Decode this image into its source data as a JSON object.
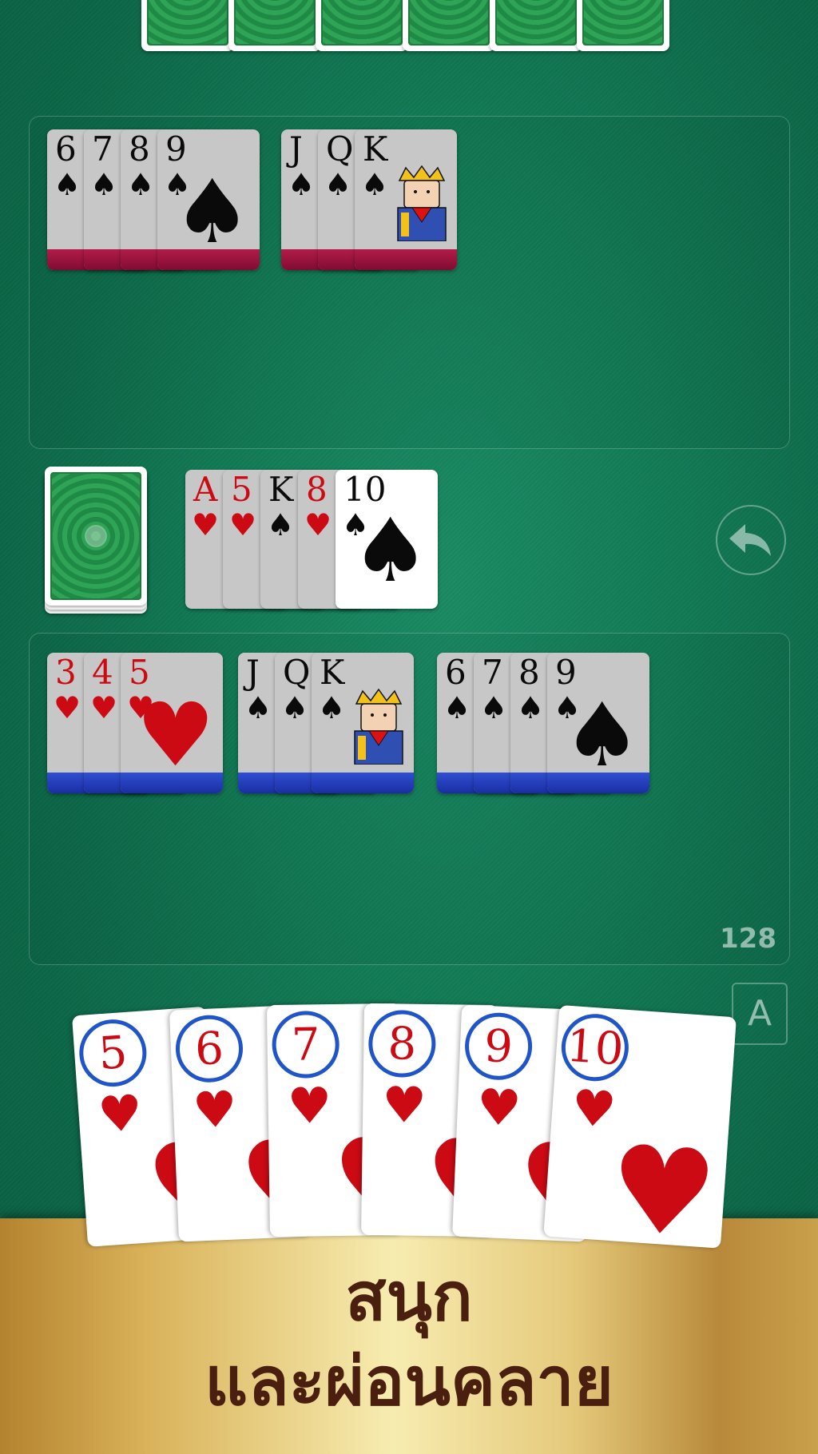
{
  "opponent": {
    "hand_count": 6
  },
  "opponent_melds": [
    {
      "strip": "maroon",
      "cards": [
        {
          "rank": "6",
          "suit": "♠",
          "color": "black"
        },
        {
          "rank": "7",
          "suit": "♠",
          "color": "black"
        },
        {
          "rank": "8",
          "suit": "♠",
          "color": "black"
        },
        {
          "rank": "9",
          "suit": "♠",
          "color": "black"
        }
      ]
    },
    {
      "strip": "maroon",
      "cards": [
        {
          "rank": "J",
          "suit": "♠",
          "color": "black"
        },
        {
          "rank": "Q",
          "suit": "♠",
          "color": "black"
        },
        {
          "rank": "K",
          "suit": "♠",
          "color": "black"
        }
      ]
    }
  ],
  "discard_pile": [
    {
      "rank": "A",
      "suit": "♥",
      "color": "red"
    },
    {
      "rank": "5",
      "suit": "♥",
      "color": "red"
    },
    {
      "rank": "K",
      "suit": "♠",
      "color": "black"
    },
    {
      "rank": "8",
      "suit": "♥",
      "color": "red"
    },
    {
      "rank": "10",
      "suit": "♠",
      "color": "black"
    }
  ],
  "player_melds": [
    {
      "strip": "blue",
      "cards": [
        {
          "rank": "3",
          "suit": "♥",
          "color": "red"
        },
        {
          "rank": "4",
          "suit": "♥",
          "color": "red"
        },
        {
          "rank": "5",
          "suit": "♥",
          "color": "red"
        }
      ]
    },
    {
      "strip": "blue",
      "cards": [
        {
          "rank": "J",
          "suit": "♠",
          "color": "black"
        },
        {
          "rank": "Q",
          "suit": "♠",
          "color": "black"
        },
        {
          "rank": "K",
          "suit": "♠",
          "color": "black"
        }
      ]
    },
    {
      "strip": "blue",
      "cards": [
        {
          "rank": "6",
          "suit": "♠",
          "color": "black"
        },
        {
          "rank": "7",
          "suit": "♠",
          "color": "black"
        },
        {
          "rank": "8",
          "suit": "♠",
          "color": "black"
        },
        {
          "rank": "9",
          "suit": "♠",
          "color": "black"
        }
      ]
    }
  ],
  "score": "128",
  "auto_button_label": "A",
  "undo_icon": "undo-arrow-icon",
  "player_hand": [
    {
      "rank": "5",
      "suit": "♥"
    },
    {
      "rank": "6",
      "suit": "♥"
    },
    {
      "rank": "7",
      "suit": "♥"
    },
    {
      "rank": "8",
      "suit": "♥"
    },
    {
      "rank": "9",
      "suit": "♥"
    },
    {
      "rank": "10",
      "suit": "♥"
    }
  ],
  "banner": {
    "line1": "สนุก",
    "line2": "และผ่อนคลาย"
  },
  "colors": {
    "felt": "#117a55",
    "red_suit": "#cc0a14",
    "player_strip": "#1a2ea3",
    "opponent_strip": "#7f0c31",
    "banner_text": "#4a1f10"
  }
}
